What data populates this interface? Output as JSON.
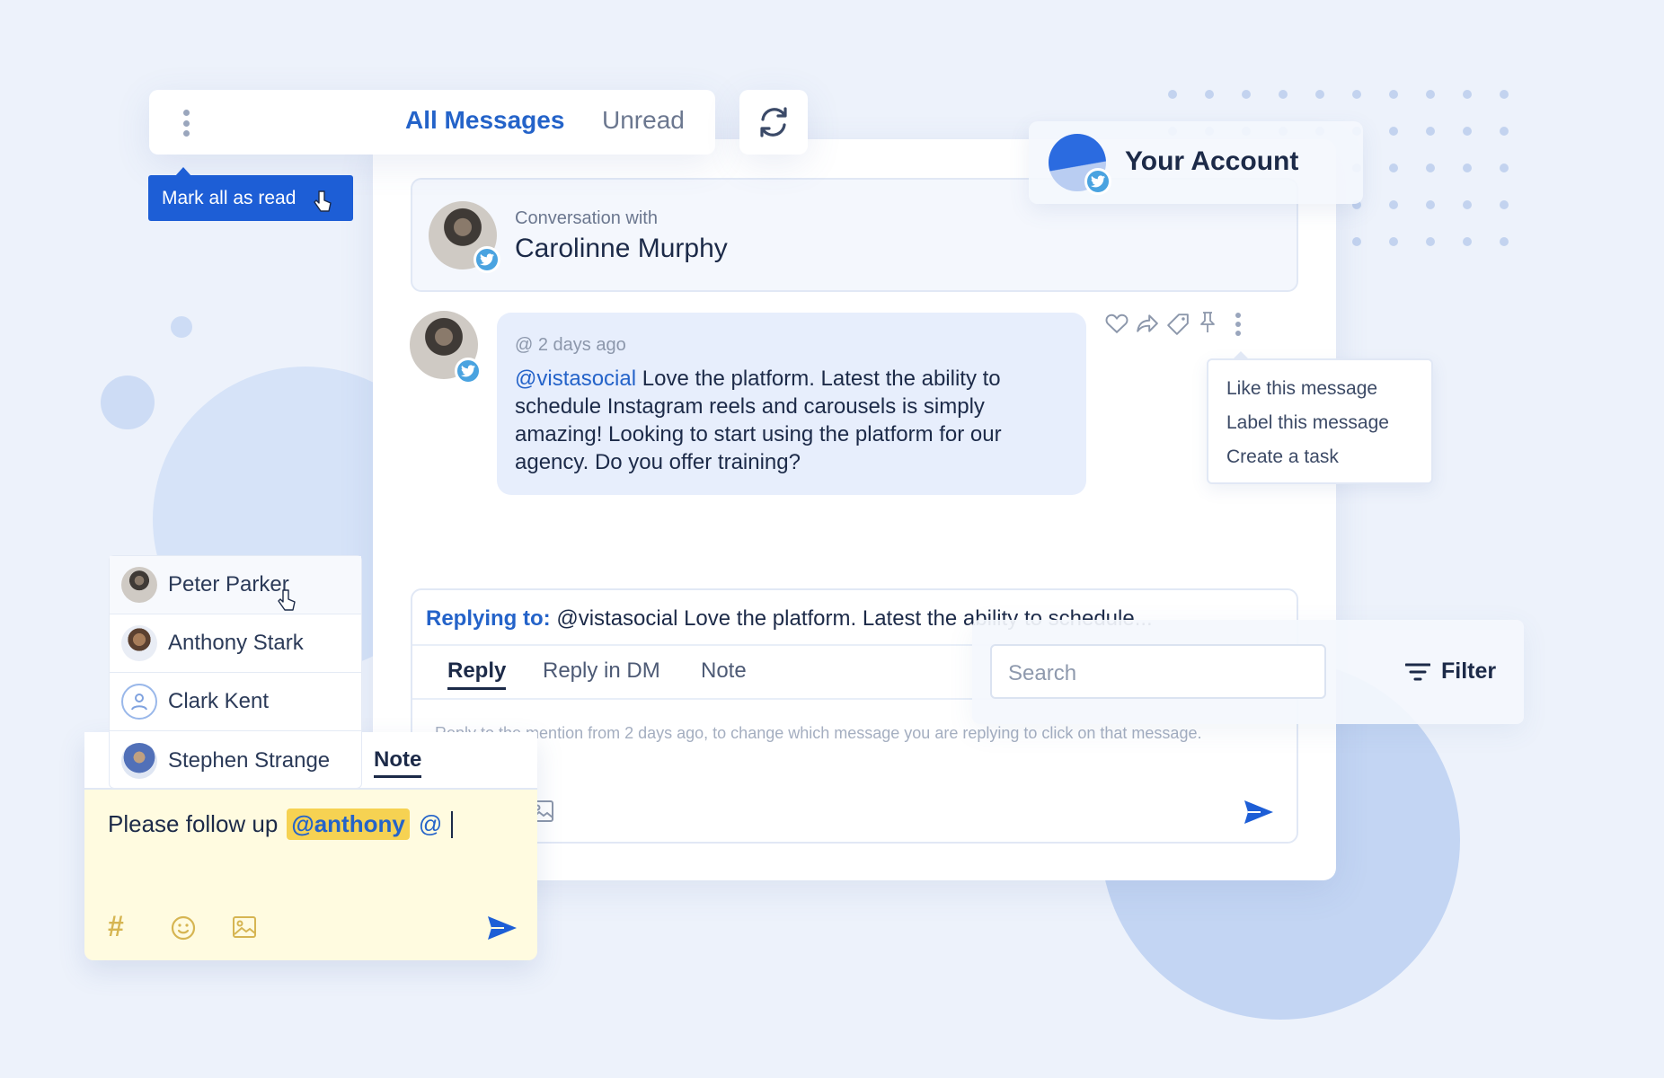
{
  "colors": {
    "accent": "#1d5ed6",
    "tab_active": "#2463c9",
    "twitter": "#4aa3e0",
    "highlight": "#f6d252",
    "note_bg": "#fffbe0"
  },
  "tabs": {
    "all_messages": "All Messages",
    "unread": "Unread"
  },
  "tooltip": {
    "mark_all_read": "Mark all as read"
  },
  "account": {
    "label": "Your Account"
  },
  "conversation": {
    "caption": "Conversation with",
    "name": "Carolinne Murphy"
  },
  "message": {
    "time": "@ 2 days ago",
    "mention": "@vistasocial",
    "text": "Love the platform. Latest the ability to schedule Instagram reels and carousels is simply amazing! Looking to start using the platform for our agency. Do you offer training?"
  },
  "actions_menu": {
    "like": "Like this message",
    "label": "Label this message",
    "task": "Create a task"
  },
  "reply": {
    "replying_label": "Replying to:",
    "replying_text": "@vistasocial Love the platform. Latest the ability to schedule...",
    "tabs": [
      "Reply",
      "Reply in DM",
      "Note"
    ],
    "placeholder": "Reply to the mention from 2 days ago, to change which message you are replying to click on that message."
  },
  "search": {
    "placeholder": "Search",
    "filter": "Filter"
  },
  "mentions": [
    "Peter Parker",
    "Anthony Stark",
    "Clark Kent",
    "Stephen Strange"
  ],
  "note": {
    "tab": "Note",
    "text": "Please follow up",
    "tag": "@anthony",
    "cursor": "@"
  }
}
